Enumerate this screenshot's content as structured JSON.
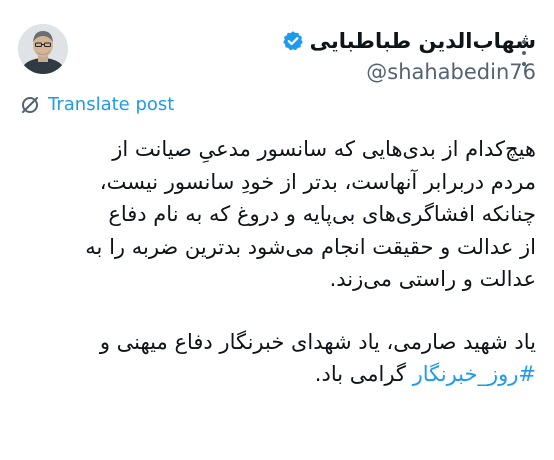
{
  "author": {
    "display_name": "شهاب‌الدین طباطبایی",
    "handle": "@shahabedin76",
    "verified": true,
    "avatar_icon": "avatar-photo-icon"
  },
  "actions": {
    "more_icon": "more-options-icon",
    "translate_label": "Translate post",
    "translate_icon": "globe-slash-icon"
  },
  "post": {
    "paragraph1": [
      "هیچ‌کدام از بدی‌هایی که سانسور مدعیِ صیانت از",
      "مردم دربرابر آنهاست، بدتر از خودِ سانسور نیست،",
      "چنانکه افشاگری‌های بی‌پایه و دروغ که به نام دفاع",
      "از عدالت و حقیقت انجام می‌شود بدترین ضربه را به",
      "عدالت و راستی می‌زند."
    ],
    "paragraph2_line1": "یاد شهید صارمی، یاد شهدای خبرنگار دفاع میهنی و",
    "hashtag": "#روز_خبرنگار",
    "paragraph2_line2_suffix": " گرامی باد."
  },
  "colors": {
    "accent": "#1d9bf0",
    "text": "#0f1419",
    "secondary": "#536471"
  }
}
